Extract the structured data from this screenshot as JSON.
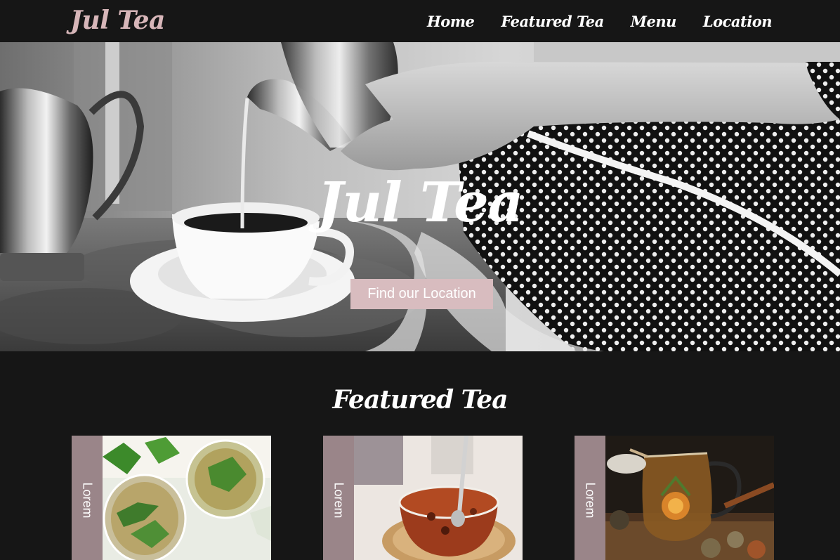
{
  "nav": {
    "brand": "Jul Tea",
    "links": [
      "Home",
      "Featured Tea",
      "Menu",
      "Location"
    ]
  },
  "hero": {
    "title": "Jul Tea",
    "button_label": "Find our Location"
  },
  "featured": {
    "title": "Featured Tea",
    "cards": [
      {
        "tab_label": "Lorem"
      },
      {
        "tab_label": "Lorem"
      },
      {
        "tab_label": "Lorem"
      }
    ]
  },
  "colors": {
    "background": "#161616",
    "brand_pink": "#d7b6b9",
    "button_pink": "#d8bcbf",
    "card_tab": "#9a8589",
    "text": "#ffffff"
  }
}
